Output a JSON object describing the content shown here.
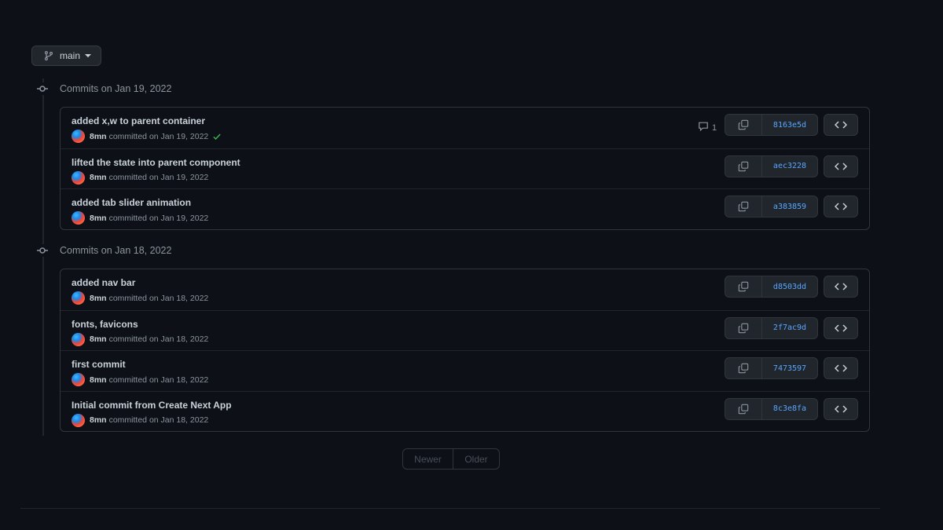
{
  "branch": {
    "label": "main"
  },
  "groups": [
    {
      "heading": "Commits on Jan 19, 2022",
      "commits": [
        {
          "title": "added x,w to parent container",
          "author": "8mn",
          "meta": "committed on Jan 19, 2022",
          "sha": "8163e5d",
          "comments": "1",
          "verified": true
        },
        {
          "title": "lifted the state into parent component",
          "author": "8mn",
          "meta": "committed on Jan 19, 2022",
          "sha": "aec3228"
        },
        {
          "title": "added tab slider animation",
          "author": "8mn",
          "meta": "committed on Jan 19, 2022",
          "sha": "a383859"
        }
      ]
    },
    {
      "heading": "Commits on Jan 18, 2022",
      "commits": [
        {
          "title": "added nav bar",
          "author": "8mn",
          "meta": "committed on Jan 18, 2022",
          "sha": "d8503dd"
        },
        {
          "title": "fonts, favicons",
          "author": "8mn",
          "meta": "committed on Jan 18, 2022",
          "sha": "2f7ac9d"
        },
        {
          "title": "first commit",
          "author": "8mn",
          "meta": "committed on Jan 18, 2022",
          "sha": "7473597"
        },
        {
          "title": "Initial commit from Create Next App",
          "author": "8mn",
          "meta": "committed on Jan 18, 2022",
          "sha": "8c3e8fa"
        }
      ]
    }
  ],
  "pagination": {
    "newer": "Newer",
    "older": "Older"
  },
  "colors": {
    "background": "#0d1117",
    "link": "#58a6ff",
    "success": "#3fb950",
    "border": "#30363d"
  },
  "icons": {
    "branch": "git-branch-icon",
    "node": "git-commit-icon",
    "copy": "copy-icon",
    "browse": "code-icon",
    "comment": "comment-icon",
    "verified": "check-icon"
  }
}
